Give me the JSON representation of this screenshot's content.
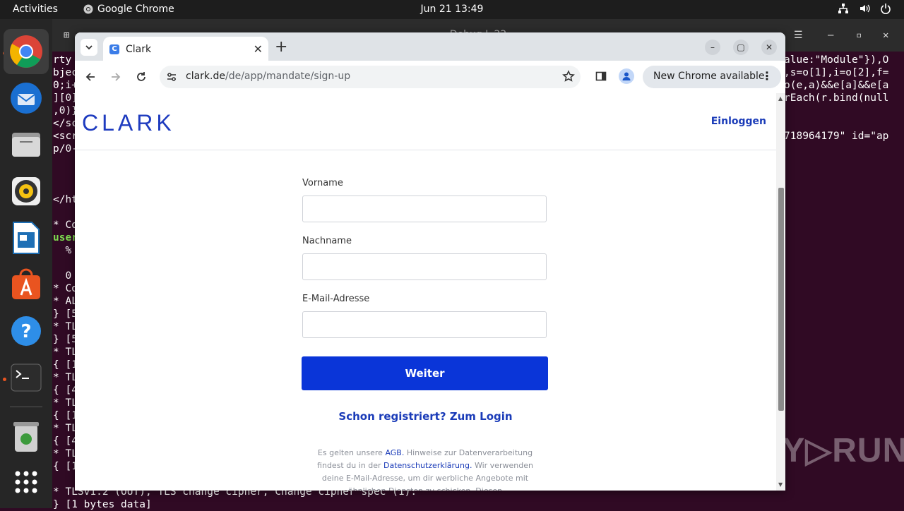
{
  "topbar": {
    "activities": "Activities",
    "app_name": "Google Chrome",
    "clock": "Jun 21  13:49"
  },
  "dock": {
    "items": [
      "chrome-icon",
      "thunderbird-icon",
      "files-icon",
      "rhythmbox-icon",
      "writer-icon",
      "app-center-icon",
      "help-icon",
      "terminal-icon",
      "trash-icon",
      "app-grid-icon"
    ]
  },
  "terminal": {
    "title": "Debug L 22",
    "left_lines": [
      "rty",
      "bjec",
      "0;i+",
      "][0]",
      ",0)}",
      "</sc",
      "<scr",
      "p/0-",
      "",
      "",
      "",
      "</ht",
      "",
      "* Co",
      "user",
      "  %",
      "",
      "  0",
      "* Co",
      "* AL",
      "} [5",
      "* TL",
      "} [5",
      "* TL",
      "{ [1",
      "* TL",
      "{ [4",
      "* TL",
      "{ [1",
      "* TL",
      "{ [4",
      "* TL",
      "{ [1"
    ],
    "green_line_index": 14,
    "right_lines": [
      "alue:\"Module\"}),O",
      ",s=o[1],i=o[2],f=",
      "o(e,a)&&e[a]&&e[a",
      "rEach(r.bind(null",
      "",
      "",
      "718964179\" id=\"ap"
    ],
    "bottom_line_1": "* TLSv1.2 (OUT), TLS change cipher, Change cipher spec (1):",
    "bottom_line_2": "} [1 bytes data]"
  },
  "browser": {
    "tab_title": "Clark",
    "tab_favicon": "C",
    "url_host": "clark.de",
    "url_path": "/de/app/mandate/sign-up",
    "update_label": "New Chrome available"
  },
  "page": {
    "logo": "CLARK",
    "login_link": "Einloggen",
    "fields": [
      {
        "label": "Vorname",
        "value": ""
      },
      {
        "label": "Nachname",
        "value": ""
      },
      {
        "label": "E-Mail-Adresse",
        "value": ""
      }
    ],
    "submit": "Weiter",
    "register_link": "Schon registriert? Zum Login",
    "legal": {
      "part1": "Es gelten unsere ",
      "agb": "AGB.",
      "part2": " Hinweise zur Datenverarbeitung findest du in der ",
      "privacy": "Datenschutzerklärung.",
      "part3": " Wir verwenden deine E-Mail-Adresse, um dir werbliche Angebote mit ähnlichen Diensten zu schicken. Diesen"
    }
  },
  "colors": {
    "brand": "#1e3bbf",
    "button": "#0a35d8",
    "terminal_bg": "#300a24"
  },
  "watermark": "ANY RUN"
}
